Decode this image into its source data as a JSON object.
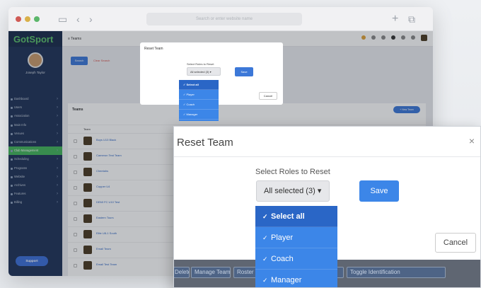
{
  "browser": {
    "url_placeholder": "Search or enter website name"
  },
  "app": {
    "logo": "GotSport",
    "user_name": "Joseph Taylor",
    "user_email": "",
    "page_title": "Teams",
    "sidebar": [
      {
        "label": "Dashboard",
        "active": false
      },
      {
        "label": "Users",
        "active": false
      },
      {
        "label": "Association",
        "active": false
      },
      {
        "label": "Main Info",
        "active": false
      },
      {
        "label": "Venues",
        "active": false
      },
      {
        "label": "Communications",
        "active": false
      },
      {
        "label": "Club Management",
        "active": true
      },
      {
        "label": "Scheduling",
        "active": false
      },
      {
        "label": "Programs",
        "active": false
      },
      {
        "label": "Website",
        "active": false
      },
      {
        "label": "Archives",
        "active": false
      },
      {
        "label": "Features",
        "active": false
      },
      {
        "label": "Billing",
        "active": false
      }
    ],
    "support_label": "Support",
    "search_label": "Search",
    "reset_search_label": "Clear Search",
    "teams_heading": "Teams",
    "new_team_label": "+ New Team",
    "team_header": "Team",
    "teams": [
      {
        "name": "Boys U13 Black"
      },
      {
        "name": "Cameron Test Team"
      },
      {
        "name": "Cheetahs"
      },
      {
        "name": "Copper U4"
      },
      {
        "name": "DEMI FC U10 Test"
      },
      {
        "name": "Eastern Tours"
      },
      {
        "name": "Elite U8-1 South"
      },
      {
        "name": "Email Team"
      },
      {
        "name": "Email Test Team"
      }
    ]
  },
  "modal": {
    "title": "Reset Team",
    "label": "Select Roles to Reset",
    "select_value": "All selected (3)",
    "save_label": "Save",
    "cancel_label": "Cancel",
    "options": [
      {
        "label": "Select all",
        "selected": true
      },
      {
        "label": "Player",
        "selected": false
      },
      {
        "label": "Coach",
        "selected": false
      },
      {
        "label": "Manager",
        "selected": false
      }
    ]
  },
  "zoom_tags": [
    "Delete Teams",
    "Manage Teams",
    "Roster",
    "Permissions",
    "Toggle Identification"
  ],
  "colors": {
    "sidebar_bg": "#1f3358",
    "active_green": "#43b55a",
    "accent_blue": "#3c86e8"
  }
}
